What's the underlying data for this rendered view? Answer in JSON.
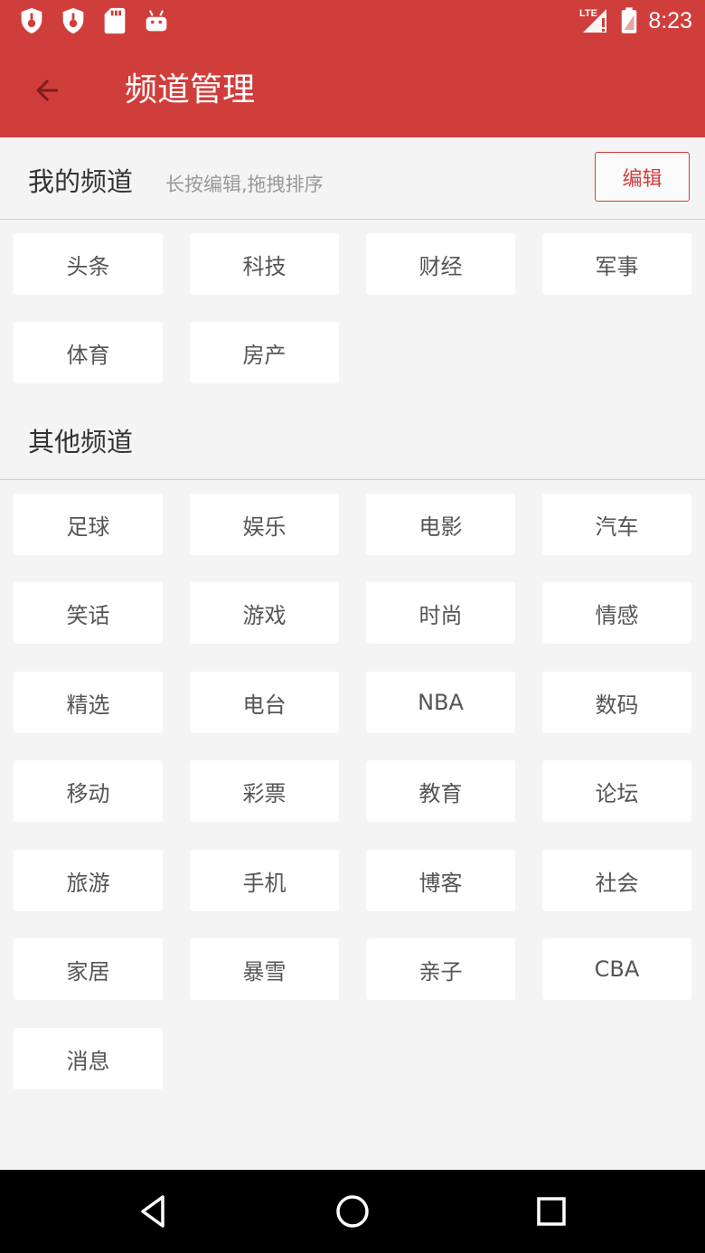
{
  "status_bar": {
    "time": "8:23",
    "network_label": "LTE",
    "left_icons": [
      "shield-alert-icon",
      "shield-alert-icon",
      "sd-card-icon",
      "android-icon"
    ],
    "right_icons": [
      "signal-icon",
      "battery-alert-icon"
    ]
  },
  "app_bar": {
    "title": "频道管理",
    "back_icon": "arrow-left-icon"
  },
  "my_channels": {
    "title": "我的频道",
    "hint": "长按编辑,拖拽排序",
    "edit_label": "编辑",
    "items": [
      "头条",
      "科技",
      "财经",
      "军事",
      "体育",
      "房产"
    ]
  },
  "other_channels": {
    "title": "其他频道",
    "items": [
      "足球",
      "娱乐",
      "电影",
      "汽车",
      "笑话",
      "游戏",
      "时尚",
      "情感",
      "精选",
      "电台",
      "NBA",
      "数码",
      "移动",
      "彩票",
      "教育",
      "论坛",
      "旅游",
      "手机",
      "博客",
      "社会",
      "家居",
      "暴雪",
      "亲子",
      "CBA",
      "消息"
    ]
  },
  "nav_bar": {
    "icons": [
      "back-triangle-icon",
      "home-circle-icon",
      "recents-square-icon"
    ]
  },
  "colors": {
    "primary": "#d03e3c",
    "background": "#f4f4f4",
    "chip": "#ffffff",
    "chip_text": "#555555"
  }
}
